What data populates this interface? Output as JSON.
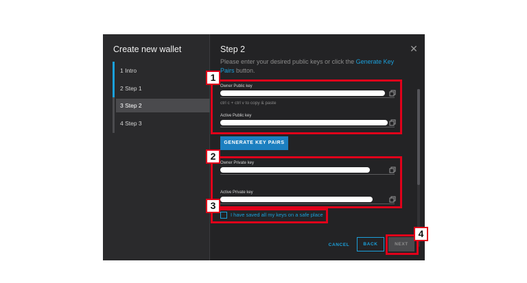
{
  "sidebar": {
    "title": "Create new wallet",
    "steps": [
      {
        "label": "1 Intro"
      },
      {
        "label": "2 Step 1"
      },
      {
        "label": "3 Step 2"
      },
      {
        "label": "4 Step 3"
      }
    ],
    "active_step": 2
  },
  "main": {
    "title": "Step 2",
    "intro_before_link": "Please enter your desired public keys or click the ",
    "intro_link": "Generate Key Pairs",
    "intro_after_link": " button.",
    "fields": {
      "owner_public": {
        "label": "Owner Public key",
        "value": ""
      },
      "helper": "ctrl c + ctrl v to copy & paste",
      "active_public": {
        "label": "Active Public key",
        "value": ""
      },
      "owner_private": {
        "label": "Owner Private key",
        "value": ""
      },
      "active_private": {
        "label": "Active Private key",
        "value": ""
      }
    },
    "generate_button": "GENERATE KEY PAIRS",
    "checkbox_label": "I have saved all my keys on a safe place",
    "checkbox_checked": false
  },
  "footer": {
    "cancel": "CANCEL",
    "back": "BACK",
    "next": "NEXT"
  },
  "annotations": [
    "1",
    "2",
    "3",
    "4"
  ],
  "colors": {
    "accent": "#1ba0db",
    "annotation_red": "#e0001a",
    "dialog_bg": "#232325"
  },
  "icons": {
    "close": "close-icon",
    "copy": "copy-icon"
  }
}
